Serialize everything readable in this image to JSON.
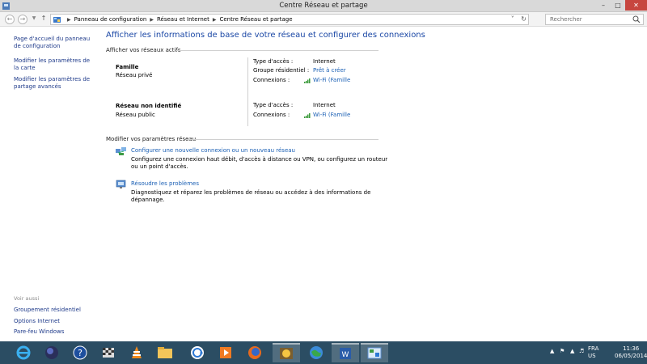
{
  "window": {
    "title": "Centre Réseau et partage",
    "controls": [
      "minimize",
      "maximize",
      "close"
    ]
  },
  "address": {
    "crumbs": [
      "Panneau de configuration",
      "Réseau et Internet",
      "Centre Réseau et partage"
    ],
    "search_placeholder": "Rechercher"
  },
  "sidebar": {
    "links": [
      "Page d'accueil du panneau de configuration",
      "Modifier les paramètres de la carte",
      "Modifier les paramètres de partage avancés"
    ],
    "see_also_label": "Voir aussi",
    "see_also": [
      "Groupement résidentiel",
      "Options Internet",
      "Pare-feu Windows"
    ]
  },
  "main": {
    "heading": "Afficher les informations de base de votre réseau et configurer des connexions",
    "active_networks_label": "Afficher vos réseaux actifs",
    "networks": [
      {
        "name": "Famille",
        "type": "Réseau privé",
        "access_label": "Type d'accès :",
        "access_value": "Internet",
        "homegroup_label": "Groupe résidentiel :",
        "homegroup_value": "Prêt à créer",
        "connections_label": "Connexions :",
        "connection_value": "Wi-Fi (Famille"
      },
      {
        "name": "Réseau non identifié",
        "type": "Réseau public",
        "access_label": "Type d'accès :",
        "access_value": "Internet",
        "connections_label": "Connexions :",
        "connection_value": "Wi-Fi (Famille"
      }
    ],
    "modify_label": "Modifier vos paramètres réseau",
    "tasks": [
      {
        "link": "Configurer une nouvelle connexion ou un nouveau réseau",
        "desc": "Configurez une connexion haut débit, d'accès à distance ou VPN, ou configurez un routeur ou un point d'accès."
      },
      {
        "link": "Résoudre les problèmes",
        "desc": "Diagnostiquez et réparez les problèmes de réseau ou accédez à des informations de dépannage."
      }
    ]
  },
  "taskbar": {
    "apps": [
      "internet-explorer",
      "firefox-nightly",
      "help",
      "flags",
      "vlc",
      "file-explorer",
      "sync",
      "media",
      "firefox",
      "program",
      "globe",
      "word",
      "control-panel"
    ],
    "language": "FRA",
    "layout": "US",
    "time": "11:36",
    "date": "06/05/2014"
  },
  "colors": {
    "link": "#1a5fb4",
    "heading": "#1a47a5",
    "taskbar": "#2b4d63",
    "close": "#c7463f"
  }
}
